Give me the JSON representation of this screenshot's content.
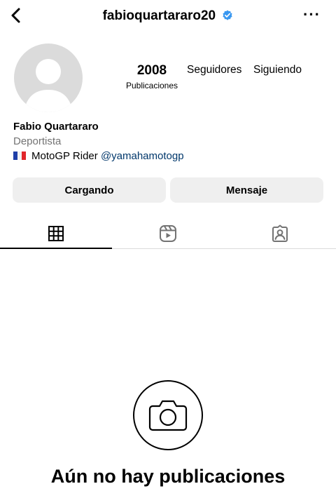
{
  "header": {
    "username": "fabioquartararo20",
    "verified": true,
    "more_label": "···"
  },
  "profile": {
    "posts_count": "2008",
    "posts_label": "Publicaciones",
    "followers_label": "Seguidores",
    "following_label": "Siguiendo",
    "name": "Fabio Quartararo",
    "category": "Deportista",
    "bio_text": "MotoGP Rider",
    "bio_mention": "@yamahamotogp"
  },
  "buttons": {
    "follow_label": "Cargando",
    "message_label": "Mensaje"
  },
  "tabs": [
    {
      "icon": "grid-icon",
      "active": true
    },
    {
      "icon": "reels-icon",
      "active": false
    },
    {
      "icon": "tagged-icon",
      "active": false
    }
  ],
  "empty_state": {
    "icon": "camera-icon",
    "text": "Aún no hay publicaciones"
  },
  "colors": {
    "verified": "#3897f0",
    "mention": "#00376b",
    "button_bg": "#efefef",
    "avatar_bg": "#dbdbdb"
  }
}
